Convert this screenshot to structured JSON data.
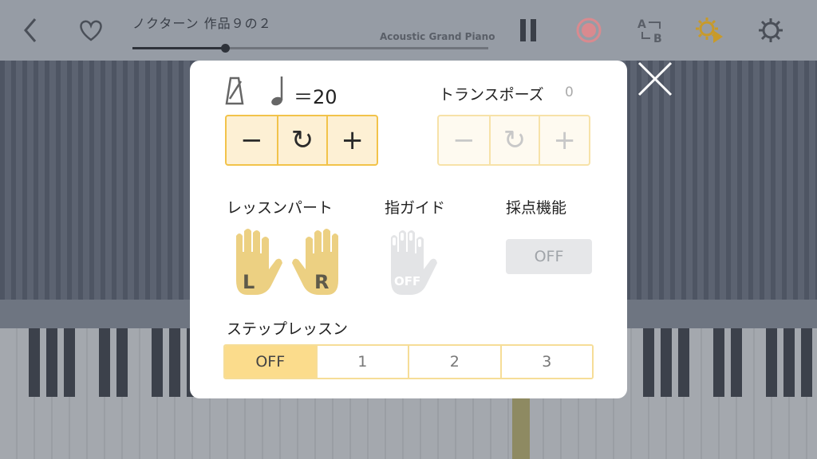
{
  "topbar": {
    "song_title": "ノクターン 作品９の２",
    "instrument": "Acoustic Grand Piano",
    "progress_fraction": 0.26,
    "icons": [
      "back-icon",
      "favorite-heart-icon",
      "pause-icon",
      "record-icon",
      "ab-repeat-icon",
      "lesson-settings-icon",
      "settings-gear-icon"
    ]
  },
  "modal": {
    "tempo": {
      "label": "＝20",
      "buttons": [
        "−",
        "↻",
        "+"
      ]
    },
    "transpose": {
      "title": "トランスポーズ",
      "value": "0",
      "buttons": [
        "−",
        "↻",
        "+"
      ]
    },
    "lesson_part": {
      "title": "レッスンパート",
      "left_hand": "L",
      "right_hand": "R"
    },
    "finger_guide": {
      "title": "指ガイド",
      "state": "OFF"
    },
    "scoring": {
      "title": "採点機能",
      "state": "OFF"
    },
    "step_lesson": {
      "title": "ステップレッスン",
      "options": [
        "OFF",
        "1",
        "2",
        "3"
      ],
      "selected": "OFF"
    }
  },
  "colors": {
    "accent": "#f2c34a",
    "hand_active": "#ecd082",
    "hand_inactive": "#e3e4e6",
    "record": "#e08a8f"
  }
}
